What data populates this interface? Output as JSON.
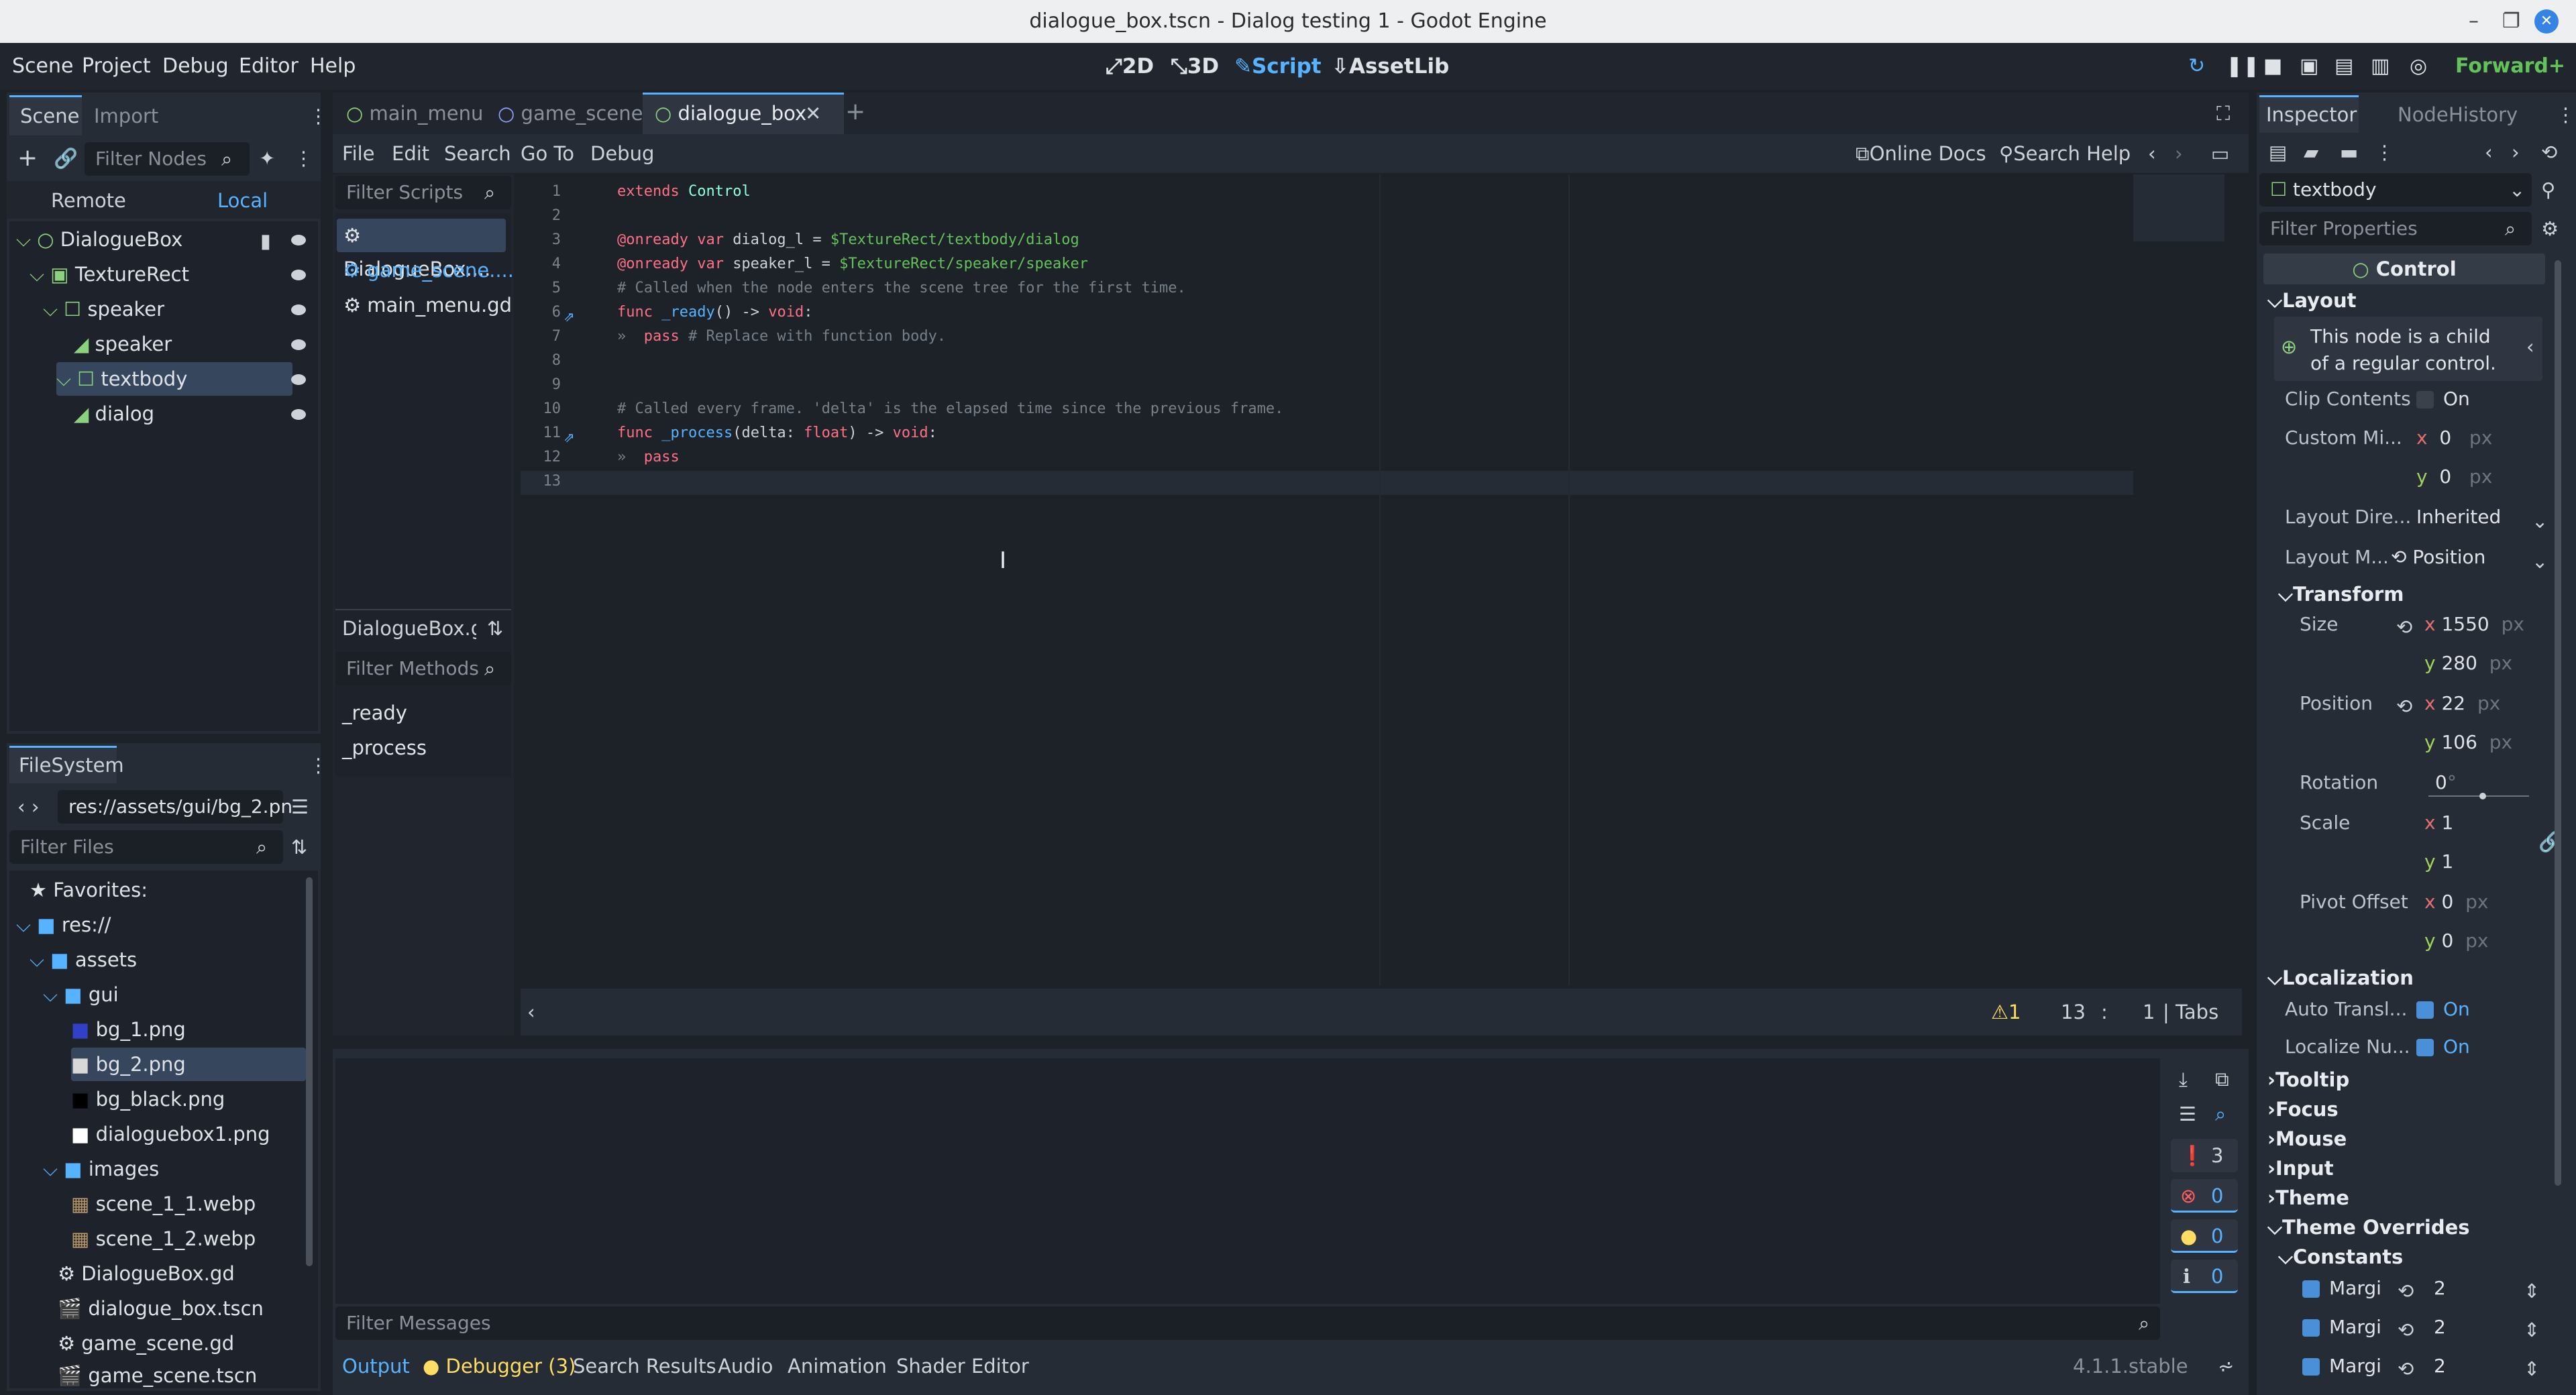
{
  "window": {
    "title": "dialogue_box.tscn - Dialog testing 1 - Godot Engine",
    "min": "–",
    "max": "❐",
    "close": "✕"
  },
  "menu": {
    "scene": "Scene",
    "project": "Project",
    "debug": "Debug",
    "editor": "Editor",
    "help": "Help"
  },
  "modes": {
    "m2d": "2D",
    "m3d": "3D",
    "script": "Script",
    "assetlib": "AssetLib"
  },
  "renderer": "Forward+",
  "scene_dock": {
    "tab_scene": "Scene",
    "tab_import": "Import",
    "filter_placeholder": "Filter Nodes",
    "remote": "Remote",
    "local": "Local",
    "nodes": [
      "DialogueBox",
      "TextureRect",
      "speaker",
      "speaker",
      "textbody",
      "dialog"
    ]
  },
  "filesystem": {
    "tab": "FileSystem",
    "path": "res://assets/gui/bg_2.pn",
    "filter_placeholder": "Filter Files",
    "items": [
      "Favorites:",
      "res://",
      "assets",
      "gui",
      "bg_1.png",
      "bg_2.png",
      "bg_black.png",
      "dialoguebox1.png",
      "images",
      "scene_1_1.webp",
      "scene_1_2.webp",
      "DialogueBox.gd",
      "dialogue_box.tscn",
      "game_scene.gd",
      "game_scene.tscn"
    ]
  },
  "editor_tabs": [
    "main_menu",
    "game_scene",
    "dialogue_box"
  ],
  "script_menu": {
    "file": "File",
    "edit": "Edit",
    "search": "Search",
    "goto": "Go To",
    "debug": "Debug",
    "online_docs": "Online Docs",
    "search_help": "Search Help"
  },
  "scripts": {
    "filter_placeholder": "Filter Scripts",
    "items": [
      "DialogueBox....",
      "game_scene....",
      "main_menu.gd"
    ],
    "current": "DialogueBox.gd",
    "methods_placeholder": "Filter Methods",
    "methods": [
      "_ready",
      "_process"
    ]
  },
  "code_lines": [
    {
      "n": "1",
      "segs": [
        [
          "kw",
          "extends "
        ],
        [
          "ty",
          "Control"
        ]
      ]
    },
    {
      "n": "2",
      "segs": []
    },
    {
      "n": "3",
      "segs": [
        [
          "kw",
          "@onready var "
        ],
        [
          "nm",
          "dialog_l = "
        ],
        [
          "np",
          "$TextureRect/textbody/dialog"
        ]
      ]
    },
    {
      "n": "4",
      "segs": [
        [
          "kw",
          "@onready var "
        ],
        [
          "nm",
          "speaker_l = "
        ],
        [
          "np",
          "$TextureRect/speaker/speaker"
        ]
      ]
    },
    {
      "n": "5",
      "segs": [
        [
          "cm",
          "# Called when the node enters the scene tree for the first time."
        ]
      ]
    },
    {
      "n": "6",
      "segs": [
        [
          "kw",
          "func "
        ],
        [
          "fn",
          "_ready"
        ],
        [
          "nm",
          "() -> "
        ],
        [
          "kw",
          "void"
        ],
        [
          "nm",
          ":"
        ]
      ]
    },
    {
      "n": "7",
      "segs": [
        [
          "cm",
          "»  "
        ],
        [
          "kw",
          "pass "
        ],
        [
          "cm",
          "# Replace with function body."
        ]
      ]
    },
    {
      "n": "8",
      "segs": []
    },
    {
      "n": "9",
      "segs": []
    },
    {
      "n": "10",
      "segs": [
        [
          "cm",
          "# Called every frame. 'delta' is the elapsed time since the previous frame."
        ]
      ]
    },
    {
      "n": "11",
      "segs": [
        [
          "kw",
          "func "
        ],
        [
          "fn",
          "_process"
        ],
        [
          "nm",
          "(delta: "
        ],
        [
          "kw",
          "float"
        ],
        [
          "nm",
          ") -> "
        ],
        [
          "kw",
          "void"
        ],
        [
          "nm",
          ":"
        ]
      ]
    },
    {
      "n": "12",
      "segs": [
        [
          "cm",
          "»  "
        ],
        [
          "kw",
          "pass"
        ]
      ]
    },
    {
      "n": "13",
      "segs": []
    }
  ],
  "status": {
    "warnings": "1",
    "line": "13",
    "sep": ":",
    "col": "1",
    "indent": "| Tabs"
  },
  "output": {
    "filter_placeholder": "Filter Messages",
    "counts": [
      "3",
      "0",
      "0",
      "0"
    ],
    "tabs": [
      "Output",
      "Debugger (3)",
      "Search Results",
      "Audio",
      "Animation",
      "Shader Editor"
    ],
    "version": "4.1.1.stable"
  },
  "inspector": {
    "tabs": [
      "Inspector",
      "Node",
      "History"
    ],
    "node": "textbody",
    "filter_placeholder": "Filter Properties",
    "class": "Control",
    "layout": "Layout",
    "note": "This node is a child of a regular control.",
    "clip": "Clip Contents",
    "on": "On",
    "custom_min": "Custom Mi...",
    "zero": "0",
    "px": "px",
    "x": "x",
    "y": "y",
    "layout_dir": "Layout Dire...",
    "inherited": "Inherited",
    "layout_mode": "Layout M...",
    "position_mode": "Position",
    "transform": "Transform",
    "size": "Size",
    "size_x": "1550",
    "size_y": "280",
    "position": "Position",
    "pos_x": "22",
    "pos_y": "106",
    "rotation": "Rotation",
    "rot": "0",
    "deg": "°",
    "scale": "Scale",
    "scale_x": "1",
    "scale_y": "1",
    "pivot": "Pivot Offset",
    "localization": "Localization",
    "auto_transl": "Auto Transl...",
    "localize_nu": "Localize Nu...",
    "tooltip": "Tooltip",
    "focus": "Focus",
    "mouse": "Mouse",
    "input": "Input",
    "theme": "Theme",
    "theme_overrides": "Theme Overrides",
    "constants": "Constants",
    "margin": "Margi",
    "margin_val": "2"
  },
  "colors": {
    "accent": "#57b3ff",
    "error": "#ff5d5d",
    "warning": "#ffdd65"
  }
}
